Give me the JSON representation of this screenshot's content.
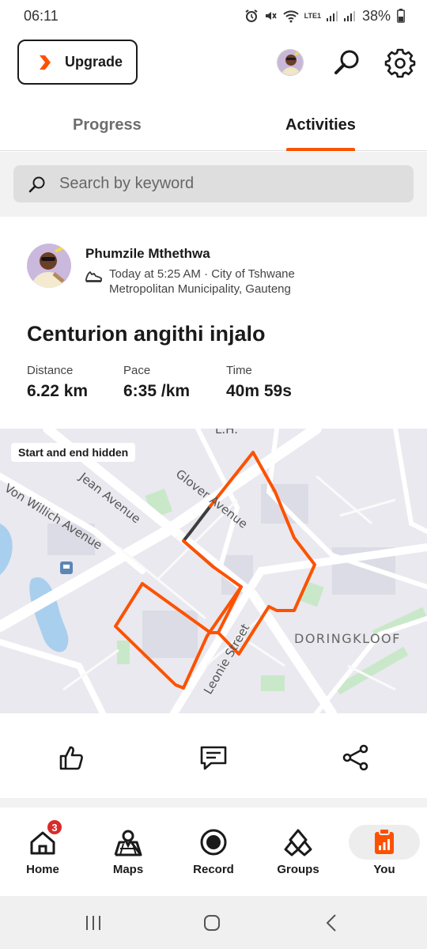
{
  "status_bar": {
    "time": "06:11",
    "battery": "38%",
    "network": "LTE1"
  },
  "top_bar": {
    "upgrade_label": "Upgrade",
    "icons": [
      "avatar",
      "search-icon",
      "settings-icon"
    ]
  },
  "tabs": [
    {
      "label": "Progress",
      "active": false
    },
    {
      "label": "Activities",
      "active": true
    }
  ],
  "search": {
    "placeholder": "Search by keyword"
  },
  "activity": {
    "athlete_name": "Phumzile Mthethwa",
    "meta": "Today at 5:25 AM · City of Tshwane Metropolitan Municipality, Gauteng",
    "title": "Centurion angithi injalo",
    "stats": [
      {
        "label": "Distance",
        "value": "6.22 km"
      },
      {
        "label": "Pace",
        "value": "6:35 /km"
      },
      {
        "label": "Time",
        "value": "40m 59s"
      }
    ],
    "map": {
      "badge": "Start and end hidden",
      "labels": {
        "glover": "Glover Avenue",
        "jean": "Jean Avenue",
        "von_willich": "Von Willich Avenue",
        "doringkloof": "DORINGKLOOF",
        "leonie": "Leonie Street",
        "lh": "L.H.",
        "edge": "ue"
      },
      "route_color": "#fc5200"
    }
  },
  "actions": [
    "like-icon",
    "comment-icon",
    "share-icon"
  ],
  "bottom_nav": [
    {
      "label": "Home",
      "badge": "3"
    },
    {
      "label": "Maps"
    },
    {
      "label": "Record"
    },
    {
      "label": "Groups"
    },
    {
      "label": "You",
      "active": true
    }
  ],
  "colors": {
    "accent": "#fc5200",
    "badge": "#d82c2c"
  }
}
